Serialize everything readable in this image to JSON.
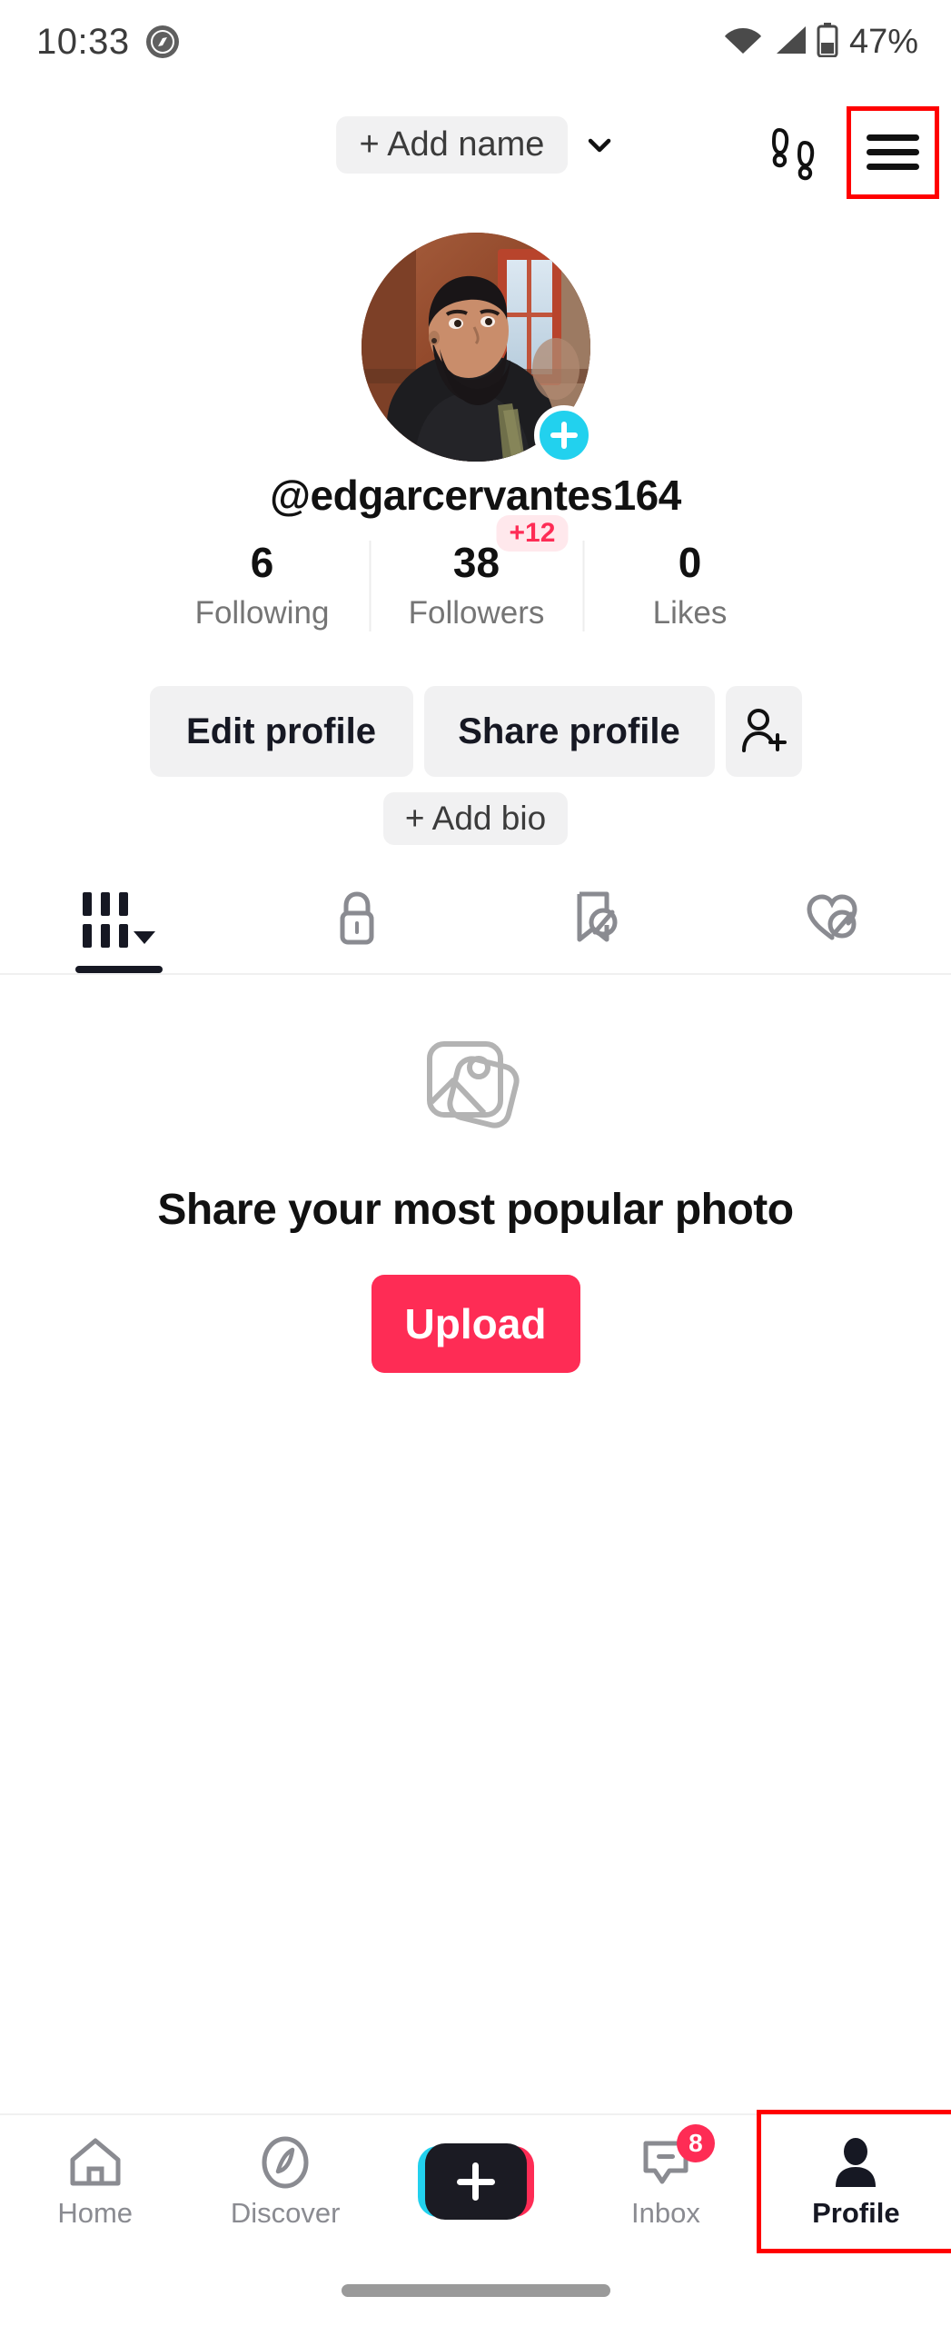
{
  "theme": {
    "accent_pink": "#FE2C55",
    "accent_cyan": "#22D1EE",
    "bg": "#FFFFFF",
    "pill_gray": "#F1F1F2",
    "muted_text": "#757575",
    "highlight_box": "#FF0000"
  },
  "status_bar": {
    "time": "10:33",
    "app_icon": "compass-app-icon",
    "wifi_icon": "wifi-icon",
    "signal_icon": "cellular-signal-icon",
    "battery_icon": "battery-icon",
    "battery_text": "47%"
  },
  "header": {
    "add_name_label": "+ Add name",
    "chevron_icon": "chevron-down-icon",
    "footprints_icon": "footprints-icon",
    "menu_icon": "hamburger-menu-icon",
    "menu_highlighted": true
  },
  "profile": {
    "avatar_alt": "profile-photo",
    "avatar_add_badge": "plus-icon",
    "username": "@edgarcervantes164",
    "add_bio_label": "+ Add bio",
    "stats": [
      {
        "value": "6",
        "label": "Following",
        "badge": ""
      },
      {
        "value": "38",
        "label": "Followers",
        "badge": "+12"
      },
      {
        "value": "0",
        "label": "Likes",
        "badge": ""
      }
    ],
    "actions": [
      {
        "label": "Edit profile",
        "icon": ""
      },
      {
        "label": "Share profile",
        "icon": ""
      },
      {
        "label": "",
        "icon": "add-person-icon"
      }
    ]
  },
  "content_tabs": [
    {
      "name": "posts-grid",
      "icon": "grid-icon",
      "active": true,
      "has_caret": true
    },
    {
      "name": "private",
      "icon": "lock-icon",
      "active": false,
      "has_caret": false
    },
    {
      "name": "hidden-favorites",
      "icon": "bookmark-slash-icon",
      "active": false,
      "has_caret": false
    },
    {
      "name": "hidden-likes",
      "icon": "heart-slash-icon",
      "active": false,
      "has_caret": false
    }
  ],
  "empty_state": {
    "icon": "photo-stack-icon",
    "title": "Share your most popular photo",
    "upload_label": "Upload"
  },
  "bottom_nav": [
    {
      "label": "Home",
      "icon": "home-icon",
      "active": false,
      "badge": ""
    },
    {
      "label": "Discover",
      "icon": "compass-icon",
      "active": false,
      "badge": ""
    },
    {
      "label": "",
      "icon": "create-plus-icon",
      "active": false,
      "badge": ""
    },
    {
      "label": "Inbox",
      "icon": "inbox-icon",
      "active": false,
      "badge": "8"
    },
    {
      "label": "Profile",
      "icon": "person-icon",
      "active": true,
      "badge": "",
      "highlighted": true
    }
  ],
  "system": {
    "gesture_pill": "android-gesture-nav-pill"
  }
}
